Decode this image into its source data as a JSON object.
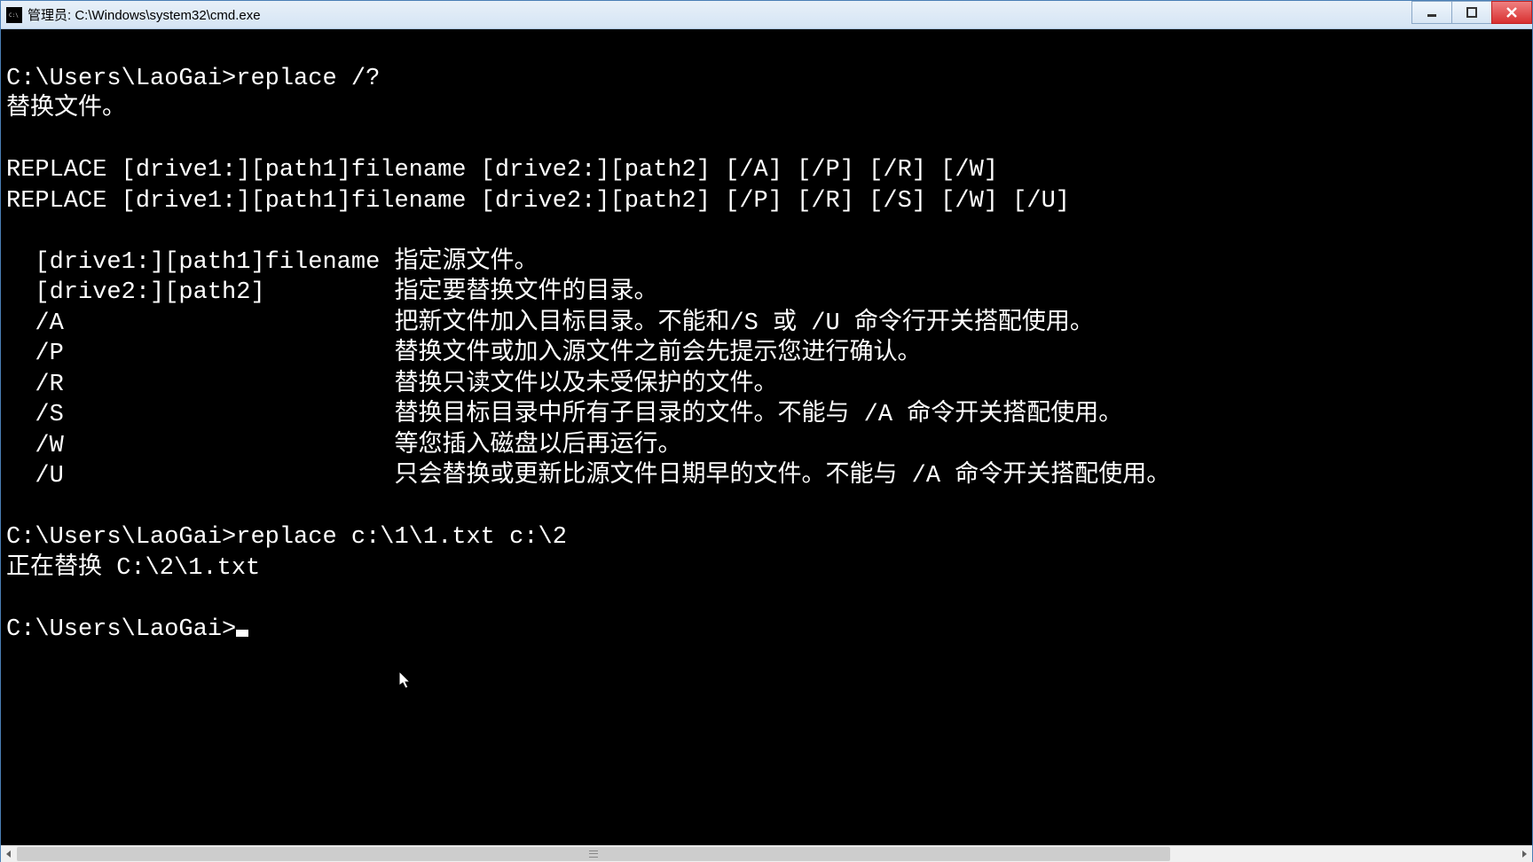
{
  "window": {
    "title": "管理员: C:\\Windows\\system32\\cmd.exe"
  },
  "terminal": {
    "lines": [
      "",
      "C:\\Users\\LaoGai>replace /?",
      "替换文件。",
      "",
      "REPLACE [drive1:][path1]filename [drive2:][path2] [/A] [/P] [/R] [/W]",
      "REPLACE [drive1:][path1]filename [drive2:][path2] [/P] [/R] [/S] [/W] [/U]",
      "",
      "  [drive1:][path1]filename 指定源文件。",
      "  [drive2:][path2]         指定要替换文件的目录。",
      "  /A                       把新文件加入目标目录。不能和/S 或 /U 命令行开关搭配使用。",
      "  /P                       替换文件或加入源文件之前会先提示您进行确认。",
      "  /R                       替换只读文件以及未受保护的文件。",
      "  /S                       替换目标目录中所有子目录的文件。不能与 /A 命令开关搭配使用。",
      "  /W                       等您插入磁盘以后再运行。",
      "  /U                       只会替换或更新比源文件日期早的文件。不能与 /A 命令开关搭配使用。",
      "",
      "C:\\Users\\LaoGai>replace c:\\1\\1.txt c:\\2",
      "正在替换 C:\\2\\1.txt",
      "",
      "C:\\Users\\LaoGai>"
    ],
    "prompt_cursor_line": 19
  }
}
